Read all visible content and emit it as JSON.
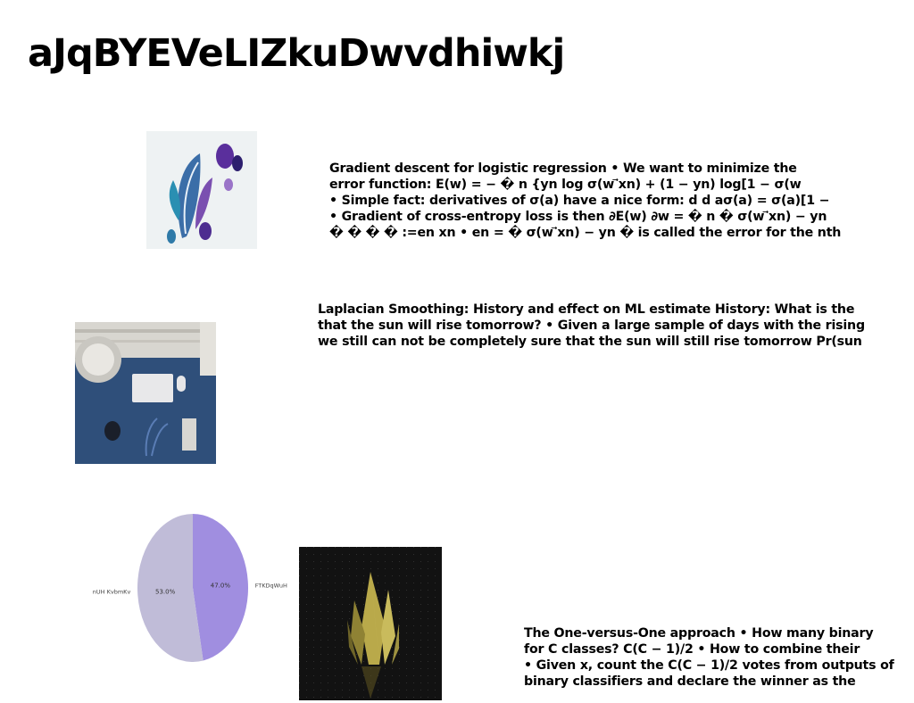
{
  "page": {
    "title": "aJqBYEVeLIZkuDwvdhiwkj"
  },
  "blocks": [
    {
      "lines": [
        "Gradient descent for logistic regression • We want to minimize the",
        "error function: E(w) = − � n {yn log σ(w ⃗xn) + (1 − yn) log[1 − σ(w",
        "• Simple fact: derivatives of σ(a) have a nice form: d d aσ(a) = σ(a)[1 −",
        "• Gradient of cross-entropy loss is then ∂E(w) ∂w = � n � σ(w ⃗xn) − yn",
        "� � � � :=en xn • en = � σ(w ⃗xn) − yn � is called the error for the nth"
      ]
    },
    {
      "lines": [
        "Laplacian Smoothing: History and effect on ML estimate History: What is the",
        "that the sun will rise tomorrow? • Given a large sample of days with the rising",
        "we still can not be completely sure that the sun will still rise tomorrow Pr(sun"
      ]
    },
    {
      "lines": [
        "The One-versus-One approach • How many binary",
        "for C classes? C(C − 1)/2 • How to combine their",
        "• Given x, count the C(C − 1)/2 votes from outputs of",
        "binary classifiers and declare the winner as the"
      ]
    }
  ],
  "chart_data": {
    "type": "pie",
    "title": "",
    "slices": [
      {
        "label": "FTKDqWuH",
        "value": 47.0,
        "display": "47.0%",
        "color": "#a08ee0"
      },
      {
        "label": "nUH KvbmKv",
        "value": 53.0,
        "display": "53.0%",
        "color": "#c0bcd8"
      }
    ],
    "start": "top, clockwise"
  },
  "images": [
    {
      "name": "leaf-art-image",
      "description_icon": "leaf-icon"
    },
    {
      "name": "desk-photo-image",
      "description_icon": "desk-icon"
    },
    {
      "name": "crystal-photo-image",
      "description_icon": "crystal-icon"
    }
  ]
}
